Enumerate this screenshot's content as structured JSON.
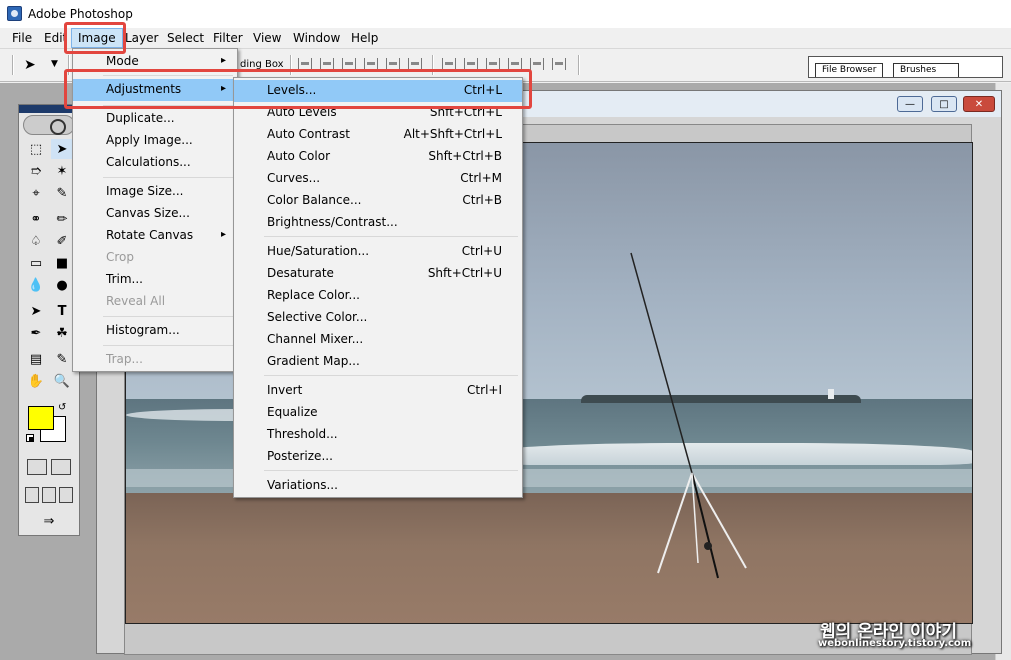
{
  "window": {
    "title": "Adobe Photoshop"
  },
  "menubar": {
    "items": [
      "File",
      "Edit",
      "Image",
      "Layer",
      "Select",
      "Filter",
      "View",
      "Window",
      "Help"
    ],
    "active": "Image"
  },
  "toolbar": {
    "bounding_box_label": "ding Box"
  },
  "palette_well": {
    "tabs": [
      "File Browser",
      "Brushes"
    ]
  },
  "image_menu": {
    "items": [
      {
        "label": "Mode",
        "submenu": true
      },
      {
        "label": "Adjustments",
        "submenu": true,
        "highlighted": true
      },
      {
        "label": "Duplicate..."
      },
      {
        "label": "Apply Image..."
      },
      {
        "label": "Calculations..."
      },
      {
        "label": "Image Size..."
      },
      {
        "label": "Canvas Size..."
      },
      {
        "label": "Rotate Canvas",
        "submenu": true
      },
      {
        "label": "Crop",
        "disabled": true
      },
      {
        "label": "Trim..."
      },
      {
        "label": "Reveal All",
        "disabled": true
      },
      {
        "label": "Histogram..."
      },
      {
        "label": "Trap...",
        "disabled": true
      }
    ]
  },
  "adjustments_menu": {
    "items": [
      {
        "label": "Levels...",
        "shortcut": "Ctrl+L",
        "highlighted": true
      },
      {
        "label": "Auto Levels",
        "shortcut": "Shft+Ctrl+L"
      },
      {
        "label": "Auto Contrast",
        "shortcut": "Alt+Shft+Ctrl+L"
      },
      {
        "label": "Auto Color",
        "shortcut": "Shft+Ctrl+B"
      },
      {
        "label": "Curves...",
        "shortcut": "Ctrl+M"
      },
      {
        "label": "Color Balance...",
        "shortcut": "Ctrl+B"
      },
      {
        "label": "Brightness/Contrast...",
        "shortcut": ""
      },
      {
        "label": "Hue/Saturation...",
        "shortcut": "Ctrl+U"
      },
      {
        "label": "Desaturate",
        "shortcut": "Shft+Ctrl+U"
      },
      {
        "label": "Replace Color...",
        "shortcut": ""
      },
      {
        "label": "Selective Color...",
        "shortcut": ""
      },
      {
        "label": "Channel Mixer...",
        "shortcut": ""
      },
      {
        "label": "Gradient Map...",
        "shortcut": ""
      },
      {
        "label": "Invert",
        "shortcut": "Ctrl+I"
      },
      {
        "label": "Equalize",
        "shortcut": ""
      },
      {
        "label": "Threshold...",
        "shortcut": ""
      },
      {
        "label": "Posterize...",
        "shortcut": ""
      },
      {
        "label": "Variations...",
        "shortcut": ""
      }
    ]
  },
  "document_window": {
    "buttons": [
      "minimize",
      "maximize",
      "close"
    ]
  },
  "toolbox": {
    "foreground_color": "#ffff00",
    "background_color": "#ffffff"
  },
  "watermark": {
    "korean": "웹의 온라인 이야기",
    "url": "webonlinestory.tistory.com"
  },
  "colors": {
    "highlight": "#91c9f7",
    "annotation": "#e2463f",
    "menu_active": "#cce4f7"
  }
}
